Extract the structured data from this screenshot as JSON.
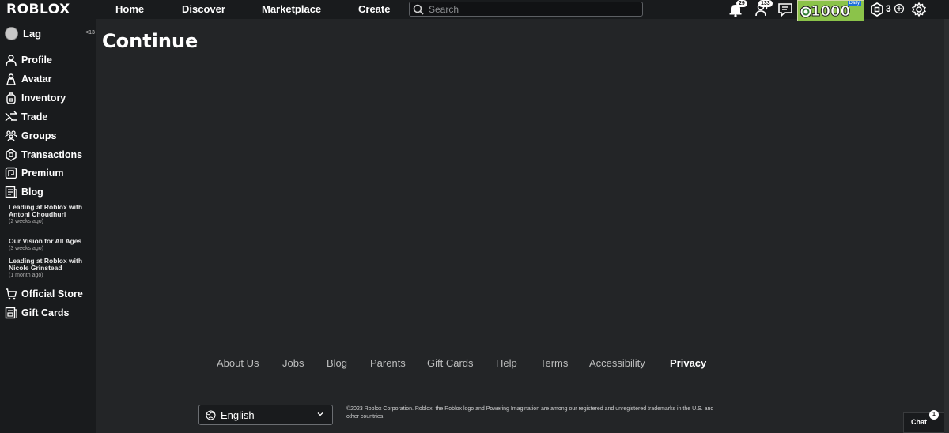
{
  "header": {
    "logo": "ROBLOX",
    "nav": [
      "Home",
      "Discover",
      "Marketplace",
      "Create"
    ],
    "search_placeholder": "Search",
    "notifications_count": "29",
    "friends_count": "133",
    "daily_amount": "1000",
    "daily_tag": "Daily",
    "robux": "3",
    "colors": {
      "bar": "#191b1d",
      "daily_bg": "#8bc34a"
    }
  },
  "sidebar": {
    "user_name": "Lag",
    "collapse_label": "<13",
    "items": [
      "Profile",
      "Avatar",
      "Inventory",
      "Trade",
      "Groups",
      "Transactions",
      "Premium",
      "Blog"
    ],
    "blog_posts": [
      {
        "title": "Leading at Roblox with Antoni Choudhuri",
        "ago": "(2 weeks ago)"
      },
      {
        "title": "Our Vision for All Ages",
        "ago": "(3 weeks ago)"
      },
      {
        "title": "Leading at Roblox with Nicole Grinstead",
        "ago": "(1 month ago)"
      }
    ],
    "bottom_items": [
      "Official Store",
      "Gift Cards"
    ]
  },
  "main": {
    "title": "Continue"
  },
  "footer": {
    "links": [
      "About Us",
      "Jobs",
      "Blog",
      "Parents",
      "Gift Cards",
      "Help",
      "Terms",
      "Accessibility",
      "Privacy"
    ],
    "language": "English",
    "copyright": "©2023 Roblox Corporation. Roblox, the Roblox logo and Powering Imagination are among our registered and unregistered trademarks in the U.S. and other countries."
  },
  "chat": {
    "label": "Chat",
    "count": "1"
  }
}
